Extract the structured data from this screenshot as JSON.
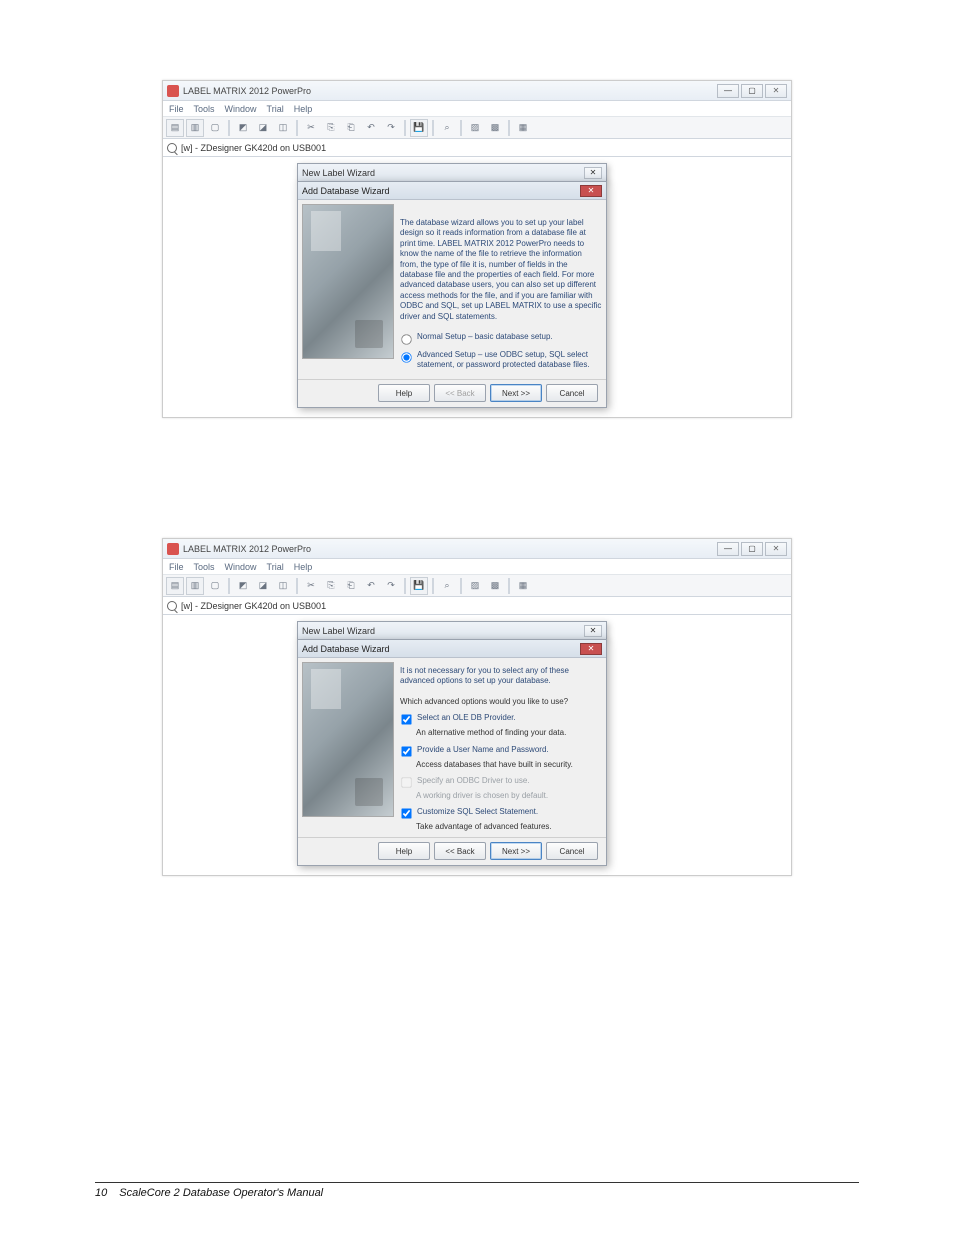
{
  "page": {
    "number": "10",
    "title": "ScaleCore 2 Database Operator's Manual"
  },
  "common": {
    "app_title": "LABEL MATRIX 2012 PowerPro",
    "menu": {
      "file": "File",
      "tools": "Tools",
      "window": "Window",
      "trial": "Trial",
      "help": "Help"
    },
    "tab_label": "[w] - ZDesigner GK420d on USB001",
    "new_label_wizard_title": "New Label Wizard",
    "add_db_wizard_title": "Add Database Wizard",
    "buttons": {
      "help": "Help",
      "back": "<< Back",
      "next": "Next >>",
      "cancel": "Cancel"
    }
  },
  "dialog1": {
    "desc": "The database wizard allows you to set up your label design so it reads information from a database file at print time. LABEL MATRIX 2012 PowerPro needs to know the name of the file to retrieve the information from, the type of file it is, number of fields in the database file and the properties of each field. For more advanced database users, you can also set up different access methods for the file, and if you are familiar with ODBC and SQL, set up LABEL MATRIX to use a specific driver and SQL statements.",
    "radio1": "Normal Setup – basic database setup.",
    "radio2": "Advanced Setup – use ODBC setup, SQL select statement, or password protected database files."
  },
  "dialog2": {
    "intro": "It is not necessary for you to select any of these advanced options to set up your database.",
    "question": "Which advanced options would you like to use?",
    "c1": "Select an OLE DB Provider.",
    "c1s": "An alternative method of finding your data.",
    "c2": "Provide a User Name and Password.",
    "c2s": "Access databases that have built in security.",
    "c3": "Specify an ODBC Driver to use.",
    "c3s": "A working driver is chosen by default.",
    "c4": "Customize SQL Select Statement.",
    "c4s": "Take advantage of advanced features."
  }
}
